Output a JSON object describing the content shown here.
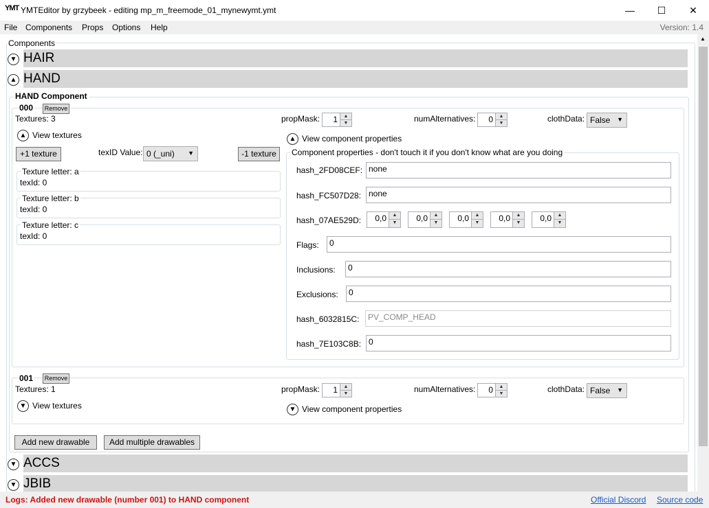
{
  "window": {
    "logo": "YMT",
    "title": "YMTEditor by grzybeek - editing mp_m_freemode_01_mynewymt.ymt",
    "minimize": "—",
    "maximize": "☐",
    "close": "✕"
  },
  "menu": {
    "items": [
      "File",
      "Components",
      "Props",
      "Options",
      "Help"
    ],
    "version": "Version: 1.4"
  },
  "components_label": "Components",
  "sections": {
    "hair": "HAIR",
    "hand": "HAND",
    "accs": "ACCS",
    "jbib": "JBIB"
  },
  "hand_component": {
    "title": "HAND Component",
    "remove_label": "Remove",
    "proptags": {
      "propmask": "propMask:",
      "numalt": "numAlternatives:",
      "clothdata": "clothData:"
    },
    "drawables": [
      {
        "id": "000",
        "textures": "Textures: 3",
        "propmask": "1",
        "numalt": "0",
        "clothdata": "False",
        "view_textures": "View textures",
        "view_props": "View component properties",
        "add_texture": "+1 texture",
        "remove_texture": "-1 texture",
        "texid_label": "texID Value:",
        "texid_value": "0 (_uni)",
        "textures_list": [
          {
            "letter": "Texture letter: a",
            "texid": "texId: 0"
          },
          {
            "letter": "Texture letter: b",
            "texid": "texId: 0"
          },
          {
            "letter": "Texture letter: c",
            "texid": "texId: 0"
          }
        ],
        "props_title": "Component properties - don't touch it if you don't know what are you doing",
        "props": {
          "hash_2fd08cef_label": "hash_2FD08CEF:",
          "hash_2fd08cef": "none",
          "hash_fc507d28_label": "hash_FC507D28:",
          "hash_fc507d28": "none",
          "hash_07ae529d_label": "hash_07AE529D:",
          "hash_07ae529d": [
            "0,0",
            "0,0",
            "0,0",
            "0,0",
            "0,0"
          ],
          "flags_label": "Flags:",
          "flags": "0",
          "inclusions_label": "Inclusions:",
          "inclusions": "0",
          "exclusions_label": "Exclusions:",
          "exclusions": "0",
          "hash_6032815c_label": "hash_6032815C:",
          "hash_6032815c": "PV_COMP_HEAD",
          "hash_7e103c8b_label": "hash_7E103C8B:",
          "hash_7e103c8b": "0"
        }
      },
      {
        "id": "001",
        "textures": "Textures: 1",
        "propmask": "1",
        "numalt": "0",
        "clothdata": "False",
        "view_textures": "View textures",
        "view_props": "View component properties"
      }
    ],
    "add_drawable": "Add new drawable",
    "add_multiple": "Add multiple drawables"
  },
  "status": {
    "log": "Logs: Added new drawable (number 001) to HAND component",
    "discord": "Official Discord",
    "source": "Source code"
  },
  "icons": {
    "up": "chevron-up-icon",
    "down": "chevron-down-icon"
  }
}
